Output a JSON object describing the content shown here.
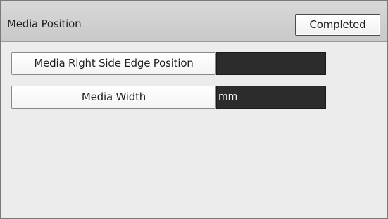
{
  "header": {
    "title": "Media Position",
    "completed_label": "Completed"
  },
  "settings": [
    {
      "label": "Media Right Side Edge Position",
      "value": "",
      "unit": ""
    },
    {
      "label": "Media Width",
      "value": "",
      "unit": "mm"
    }
  ],
  "colors": {
    "header_bg": "#d0d0d0",
    "screen_bg": "#ececec",
    "value_field_bg": "#2c2c2c",
    "value_text": "#f2f2f2"
  }
}
